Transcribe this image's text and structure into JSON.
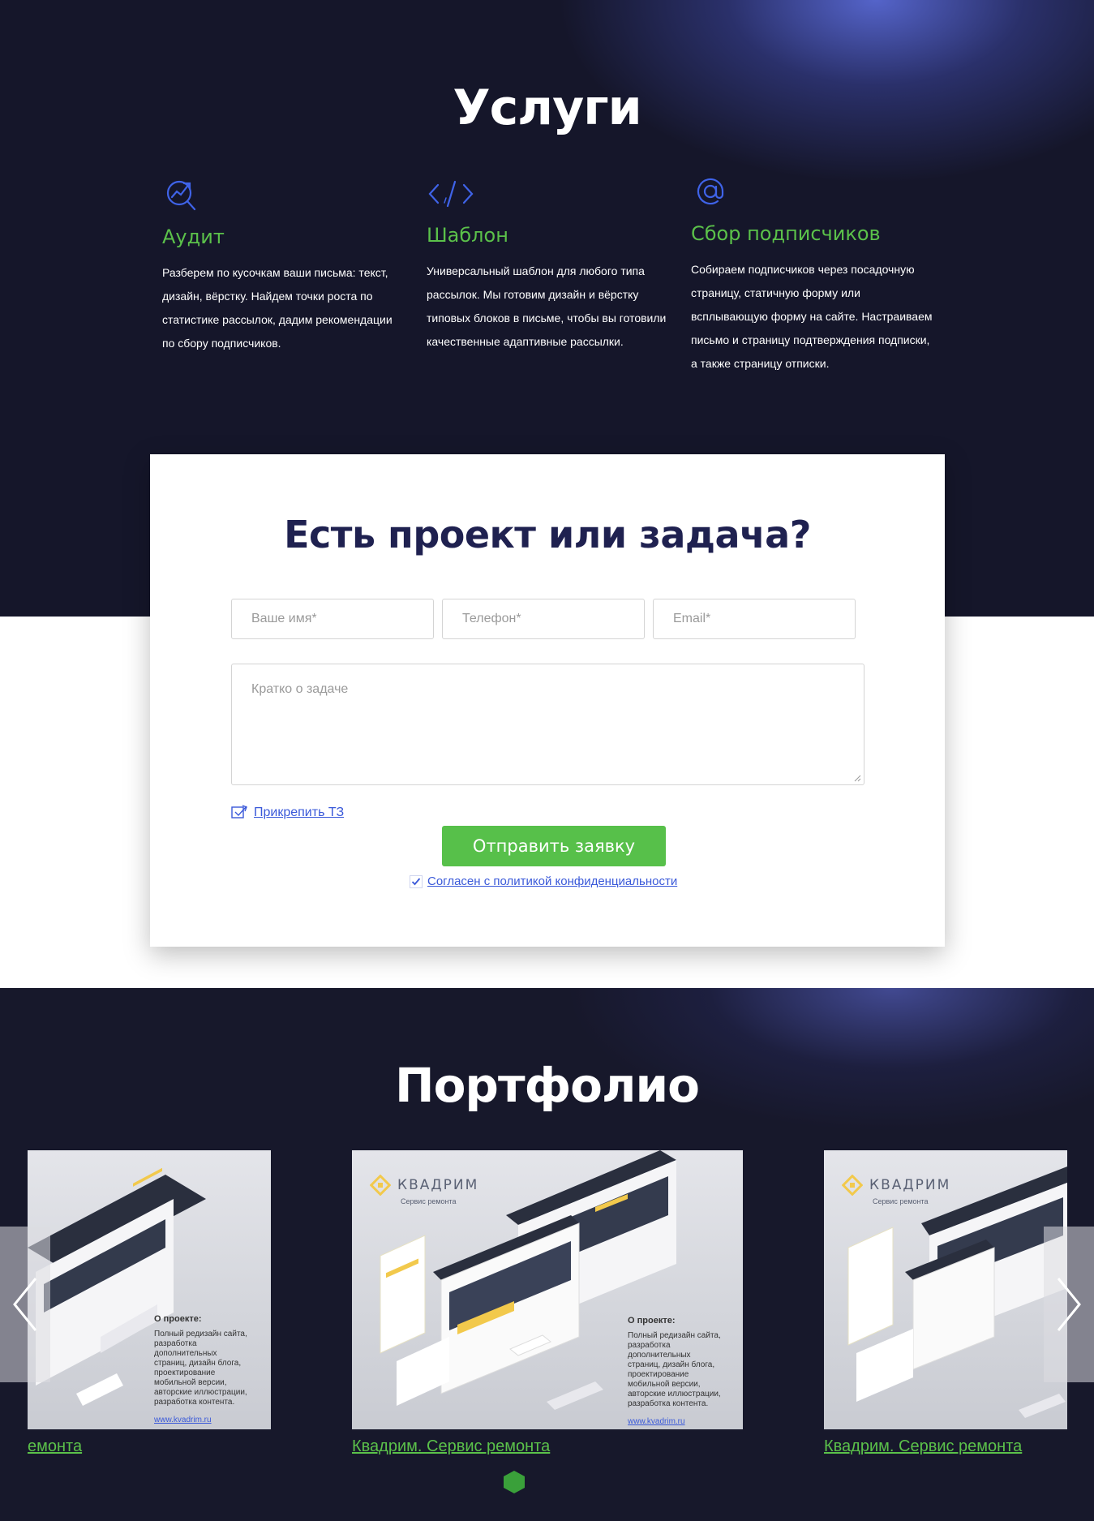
{
  "services": {
    "title": "Услуги",
    "items": [
      {
        "icon": "analytics-icon",
        "title": "Аудит",
        "text": "Разберем по кусочкам ваши письма: текст, дизайн, вёрстку. Найдем точки роста по статистике рассылок, дадим рекомендации по сбору подписчиков."
      },
      {
        "icon": "code-icon",
        "title": "Шаблон",
        "text": "Универсальный шаблон для любого типа рассылок. Мы готовим дизайн и вёрстку типовых блоков в письме, чтобы вы готовили качественные адаптивные рассылки."
      },
      {
        "icon": "at-icon",
        "title": "Сбор подписчиков",
        "text": "Собираем подписчиков через посадочную страницу, статичную форму или всплывающую форму на сайте. Настраиваем письмо и страницу подтверждения подписки, а также страницу отписки."
      }
    ]
  },
  "form": {
    "title": "Есть проект или задача?",
    "name_placeholder": "Ваше имя*",
    "phone_placeholder": "Телефон*",
    "email_placeholder": "Email*",
    "message_placeholder": "Кратко о задаче",
    "attach_label": "Прикрепить ТЗ",
    "submit_label": "Отправить заявку",
    "consent_label": "Согласен с политикой конфиденциальности",
    "consent_checked": true
  },
  "portfolio": {
    "title": "Портфолио",
    "slides": [
      {
        "caption": "емонта",
        "about_title": "О проекте:",
        "about_text": "Полный редизайн сайта, разработка дополнительных страниц, дизайн блога, проектирование мобильной версии, авторские иллюстрации, разработка контента.",
        "site": "www.kvadrim.ru"
      },
      {
        "caption": "Квадрим. Сервис ремонта",
        "brand": "КВАДРИМ",
        "brand_sub": "Сервис ремонта",
        "about_title": "О проекте:",
        "about_text": "Полный редизайн сайта, разработка дополнительных страниц, дизайн блога, проектирование мобильной версии, авторские иллюстрации, разработка контента.",
        "site": "www.kvadrim.ru"
      },
      {
        "caption": "Квадрим. Сервис ремонта",
        "brand": "КВАДРИМ",
        "brand_sub": "Сервис ремонта"
      }
    ]
  },
  "colors": {
    "accent_green": "#5bc14a",
    "link_blue": "#3a59d9",
    "dark_bg": "#15162a",
    "heading_navy": "#1f2150"
  }
}
